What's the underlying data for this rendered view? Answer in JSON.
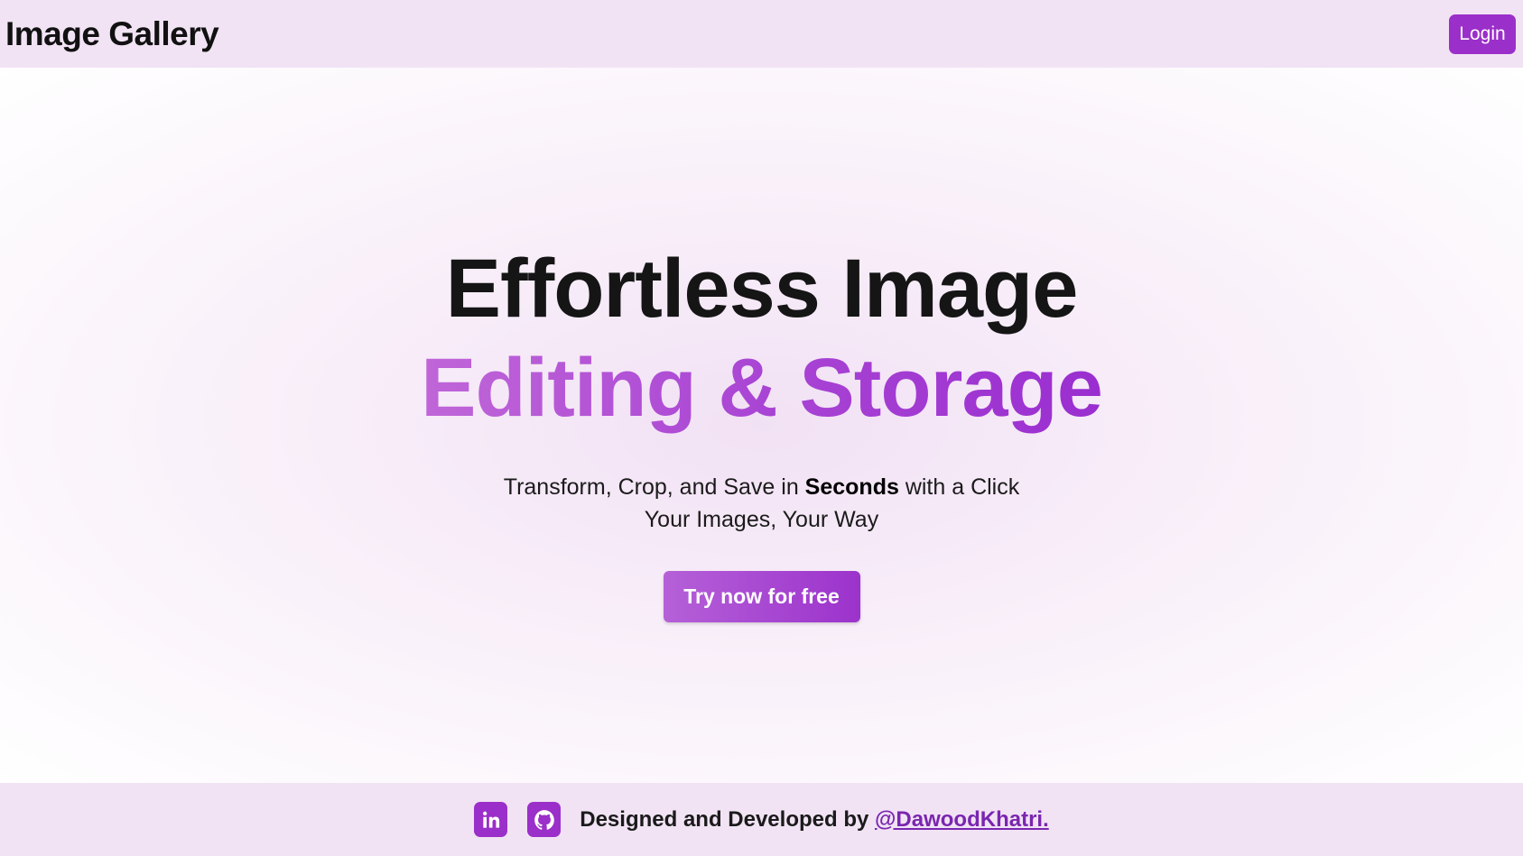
{
  "header": {
    "brand": "Image Gallery",
    "login_label": "Login"
  },
  "hero": {
    "title_line1": "Effortless Image",
    "title_line2": "Editing & Storage",
    "subtitle_prefix": "Transform, Crop, and Save in ",
    "subtitle_bold": "Seconds",
    "subtitle_suffix": " with a Click",
    "subtitle_line2": "Your Images, Your Way",
    "cta_label": "Try now for free"
  },
  "footer": {
    "credit_text": "Designed and Developed by ",
    "credit_link": "@DawoodKhatri.",
    "social_icons": [
      "linkedin-icon",
      "github-icon"
    ]
  },
  "colors": {
    "accent": "#9b2fc9",
    "band_background": "#f1e3f4",
    "gradient_start": "#c066d8",
    "gradient_end": "#9a2ed0"
  }
}
